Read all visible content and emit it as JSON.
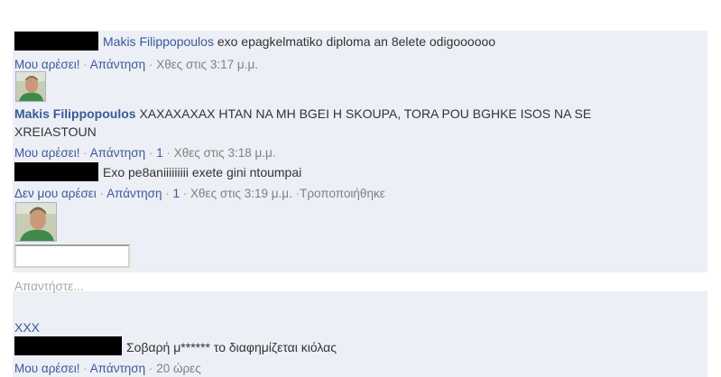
{
  "comments": [
    {
      "author": "Makis Filippopoulos",
      "text": "exo epagkelmatiko diploma an 8elete odigoooooo",
      "like_label": "Μου αρέσει!",
      "reply_label": "Απάντηση",
      "time": "Χθες στις 3:17 μ.μ."
    },
    {
      "author": "Makis Filippopoulos",
      "text_line1": "XAXAXAXAX HTAN NA MH BGEI H SKOUPA, TORA POU BGHKE ISOS NA SE",
      "text_line2": "XREIASTOUN",
      "like_label": "Μου αρέσει!",
      "reply_label": "Απάντηση",
      "like_count": "1",
      "time": "Χθες στις 3:18 μ.μ."
    },
    {
      "text": "Exo pe8aniiiiiiiii exete gini ntoumpai",
      "unlike_label": "Δεν μου αρέσει",
      "reply_label": "Απάντηση",
      "like_count": "1",
      "time": "Χθες στις 3:19 μ.μ.",
      "edited_label": "Τροποποιήθηκε"
    }
  ],
  "reply_box": {
    "placeholder": "Απαντήστε..."
  },
  "post": {
    "author": "XXX",
    "text": "Σοβαρή μ****** το διαφημίζεται κιόλας",
    "like_label": "Μου αρέσει!",
    "reply_label": "Απάντηση",
    "time": "20 ώρες"
  }
}
